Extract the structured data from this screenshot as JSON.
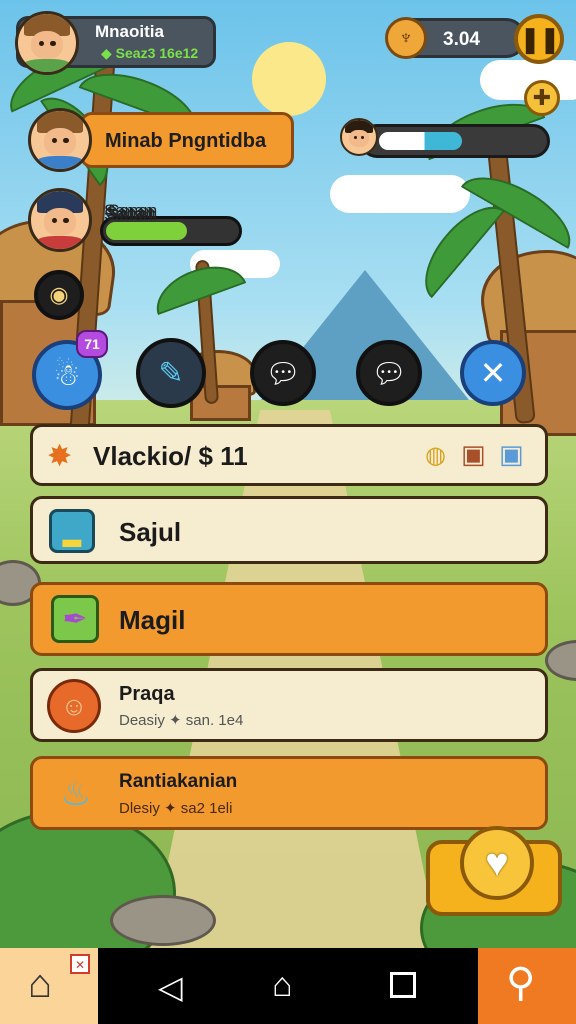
{
  "player": {
    "name": "Mnaoitia",
    "score": "Seaz3 16e12"
  },
  "currency": {
    "value": "3.04"
  },
  "quest_banner": {
    "title": "Minab Pngntidba"
  },
  "companion": {
    "name": "Sanan",
    "bar_fill": 0.62
  },
  "top_progress": {
    "bar_fill": 0.55
  },
  "list": {
    "items": [
      {
        "title": "Vlackio/ $ 11",
        "style": "cream"
      },
      {
        "title": "Sajul",
        "style": "cream"
      },
      {
        "title": "Magil",
        "style": "orange"
      },
      {
        "title": "Praqa",
        "subtitle": "Deasiy ✦ san. 1e4",
        "style": "cream"
      },
      {
        "title": "Rantiakanian",
        "subtitle": "Dlesiy ✦ sa2 1eli",
        "style": "orange"
      }
    ]
  },
  "badges": {
    "notification": "71"
  },
  "colors": {
    "accent_orange": "#f29a2e",
    "panel_dark": "#4a5560",
    "cream": "#f6ecd0",
    "progress_green": "#7fd13b",
    "progress_blue": "#3fb8d8"
  },
  "icons": {
    "pause": "pause-icon",
    "coin": "coin-icon",
    "plus": "plus-icon",
    "home": "home-icon",
    "search": "search-icon",
    "heart": "heart-icon"
  }
}
